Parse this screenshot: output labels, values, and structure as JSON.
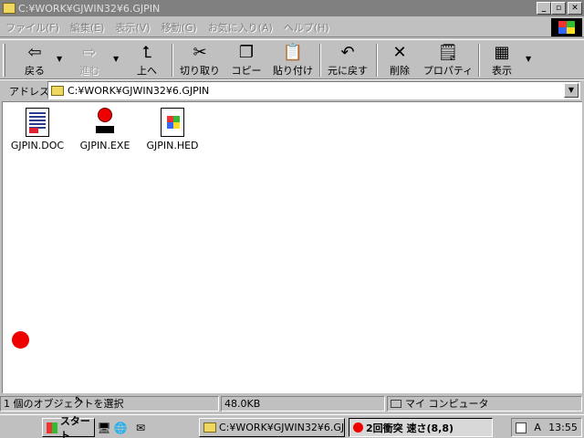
{
  "window": {
    "title": "C:¥WORK¥GJWIN32¥6.GJPIN",
    "buttons": {
      "minimize": "_",
      "maximize": "▫",
      "close": "✕"
    }
  },
  "menu": [
    "ファイル(F)",
    "編集(E)",
    "表示(V)",
    "移動(G)",
    "お気に入り(A)",
    "ヘルプ(H)"
  ],
  "toolbar": {
    "back": "戻る",
    "forward": "進む",
    "up": "上へ",
    "cut": "切り取り",
    "copy": "コピー",
    "paste": "貼り付け",
    "undo": "元に戻す",
    "delete": "削除",
    "properties": "プロパティ",
    "view": "表示"
  },
  "address": {
    "label": "アドレス",
    "value": "C:¥WORK¥GJWIN32¥6.GJPIN"
  },
  "files": [
    {
      "name": "GJPIN.DOC",
      "icon": "document-icon"
    },
    {
      "name": "GJPIN.EXE",
      "icon": "red-ball-exe-icon"
    },
    {
      "name": "GJPIN.HED",
      "icon": "windows-help-icon"
    }
  ],
  "status": {
    "selection": "1 個のオブジェクトを選択",
    "size": "48.0KB",
    "location": "マイ コンピュータ"
  },
  "taskbar": {
    "start": "スタート",
    "tasks": [
      {
        "label": "C:¥WORK¥GJWIN32¥6.GJ...",
        "active": false
      },
      {
        "label": "2回衝突  速さ(8,8)",
        "active": true
      }
    ],
    "clock": "13:55",
    "tray_label": "A"
  }
}
